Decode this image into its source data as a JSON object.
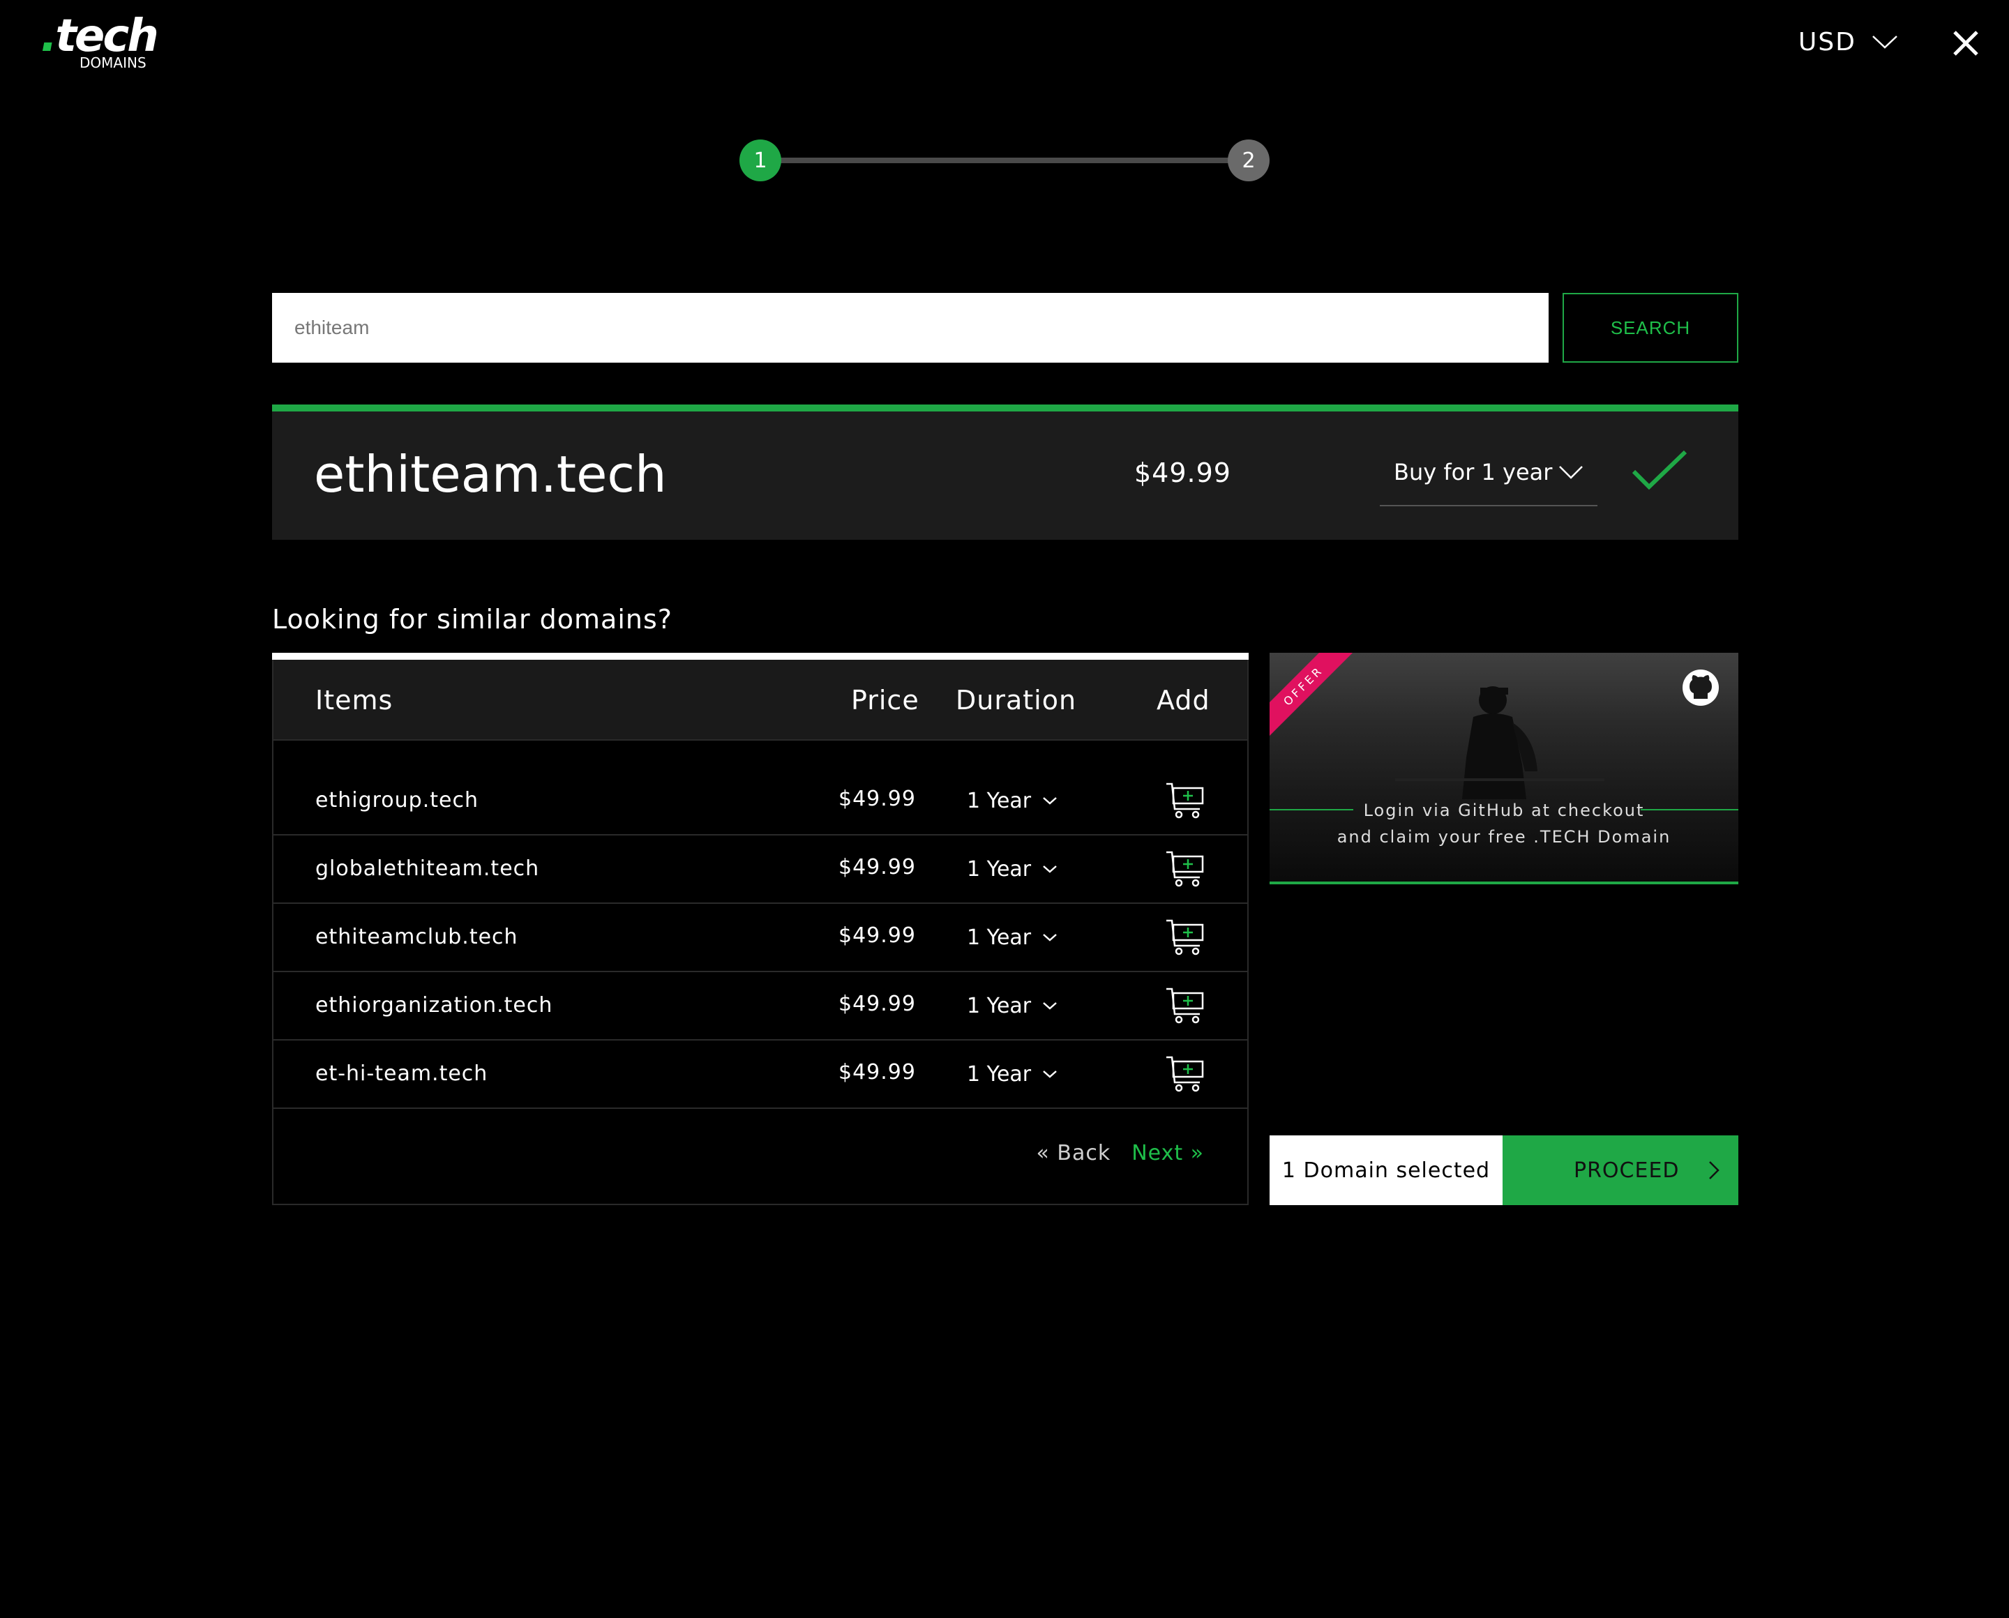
{
  "header": {
    "logo_main": "tech",
    "logo_dot": ".",
    "logo_sub": "DOMAINS",
    "currency": "USD",
    "close_icon": "close-icon"
  },
  "stepper": {
    "steps": [
      "1",
      "2"
    ],
    "active_color": "#1fa846",
    "inactive_color": "#6a6a6a"
  },
  "search": {
    "value": "ethiteam",
    "button_label": "SEARCH"
  },
  "result": {
    "domain": "ethiteam.tech",
    "price": "$49.99",
    "duration_label": "Buy for 1 year",
    "status_icon": "checkmark-icon"
  },
  "similar": {
    "title": "Looking for similar domains?",
    "columns": {
      "items": "Items",
      "price": "Price",
      "duration": "Duration",
      "add": "Add"
    },
    "rows": [
      {
        "domain": "ethigroup.tech",
        "price": "$49.99",
        "duration": "1 Year"
      },
      {
        "domain": "globalethiteam.tech",
        "price": "$49.99",
        "duration": "1 Year"
      },
      {
        "domain": "ethiteamclub.tech",
        "price": "$49.99",
        "duration": "1 Year"
      },
      {
        "domain": "ethiorganization.tech",
        "price": "$49.99",
        "duration": "1 Year"
      },
      {
        "domain": "et-hi-team.tech",
        "price": "$49.99",
        "duration": "1 Year"
      }
    ],
    "pager": {
      "back": "« Back",
      "next": "Next »"
    }
  },
  "offer": {
    "ribbon": "OFFER",
    "line1": "Login via GitHub at checkout",
    "line2": "and claim your free .TECH Domain",
    "icon": "github-icon"
  },
  "cart_summary": {
    "selected": "1 Domain selected",
    "proceed": "PROCEED"
  },
  "colors": {
    "accent": "#1fa846",
    "background": "#000000",
    "card": "#1c1c1c",
    "ribbon": "#e0115f"
  }
}
